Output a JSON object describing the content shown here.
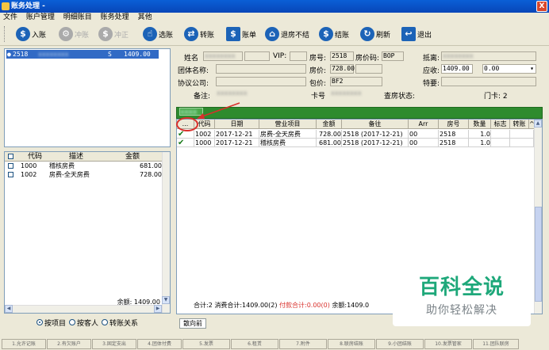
{
  "window": {
    "title": "账务处理 -",
    "close_label": "X"
  },
  "menu": [
    "文件",
    "账户管理",
    "明细账目",
    "账务处理",
    "其他"
  ],
  "toolbar": [
    {
      "label": "入账",
      "icon": "dollar-icon",
      "color": "#1c63b7",
      "glyph": "$",
      "enabled": true
    },
    {
      "label": "冲账",
      "icon": "gear-icon",
      "color": "#999999",
      "glyph": "⚙",
      "enabled": false
    },
    {
      "label": "冲正",
      "icon": "coin-refund-icon",
      "color": "#999999",
      "glyph": "$",
      "enabled": false
    },
    {
      "label": "选账",
      "icon": "pointer-hand-icon",
      "color": "#1c63b7",
      "glyph": "☝",
      "enabled": true
    },
    {
      "label": "转账",
      "icon": "transfer-arrows-icon",
      "color": "#1c63b7",
      "glyph": "⇄",
      "enabled": true
    },
    {
      "label": "账单",
      "icon": "bill-icon",
      "color": "#1c63b7",
      "glyph": "$",
      "enabled": true
    },
    {
      "label": "退房不结",
      "icon": "checkout-icon",
      "color": "#1c63b7",
      "glyph": "⌂",
      "enabled": true
    },
    {
      "label": "结账",
      "icon": "money-bag-icon",
      "color": "#1c63b7",
      "glyph": "$",
      "enabled": true
    },
    {
      "label": "刷新",
      "icon": "refresh-icon",
      "color": "#1c63b7",
      "glyph": "↻",
      "enabled": true
    },
    {
      "label": "退出",
      "icon": "exit-icon",
      "color": "#1c63b7",
      "glyph": "↩",
      "enabled": true
    }
  ],
  "account_list": {
    "selected_row": {
      "room": "2518",
      "status": "S",
      "amount": "1409.00"
    }
  },
  "left_table": {
    "headers": [
      "代码",
      "描述",
      "金额"
    ],
    "rows": [
      {
        "code": "1000",
        "desc": "稽核房费",
        "amount": "681.00"
      },
      {
        "code": "1002",
        "desc": "房费-全天房费",
        "amount": "728.00"
      }
    ],
    "balance": "余额: 1409.00"
  },
  "radios": [
    {
      "label": "按项目",
      "selected": true
    },
    {
      "label": "按客人",
      "selected": false
    },
    {
      "label": "转账关系",
      "selected": false
    }
  ],
  "form": {
    "name_label": "姓名",
    "vip_label": "VIP:",
    "room_label": "房号:",
    "room_value": "2518",
    "rate_code_label": "房价码:",
    "rate_code_value": "BOP",
    "depart_label": "抵离:",
    "group_label": "团体名称:",
    "price_label": "房价:",
    "price_value": "728.00",
    "receivable_label": "应收:",
    "receivable_value": "1409.00",
    "receivable_value2": "0.00",
    "agreement_label": "协议公司:",
    "package_label": "包价:",
    "package_value": "BF2",
    "special_label": "特要:",
    "note_label": "备注:",
    "card_label": "卡号",
    "check_status_label": "查房状态:",
    "door_card_label": "门卡: 2",
    "blurred": "xxxxxxxx"
  },
  "grid": {
    "group_tab": "xxxx",
    "headers": [
      "...",
      "代码",
      "日期",
      "营业项目",
      "金额",
      "备往",
      "Arr",
      "房号",
      "数量",
      "标志",
      "转账",
      "^"
    ],
    "rows": [
      {
        "check": "✔",
        "code": "1002",
        "date": "2017-12-21",
        "item": "房费-全天房费",
        "amount": "728.00",
        "note": "2518 (2017-12-21)",
        "arr": "00",
        "room": "2518",
        "qty": "1.0"
      },
      {
        "check": "✔",
        "code": "1000",
        "date": "2017-12-21",
        "item": "稽核房费",
        "amount": "681.00",
        "note": "2518 (2017-12-21)",
        "arr": "00",
        "room": "2518",
        "qty": "1.0"
      }
    ],
    "totals": {
      "count": "合计:2",
      "consume": "消费合计:1409.00(2)",
      "pay": "付款合计:0.00(0)",
      "balance": "余额:1409.0"
    },
    "bottom_tab": "散向前"
  },
  "statusbar": [
    "1.允许记账",
    "2.有欠账户",
    "3.固定支出",
    "4.团体付费",
    "5.发票",
    "6.租赁",
    "7.附件",
    "8.联房结账",
    "9.小团结账",
    "10.发票管家",
    "11.团队联房"
  ],
  "watermark": {
    "line1": "百科全说",
    "line2": "助你轻松解决"
  }
}
